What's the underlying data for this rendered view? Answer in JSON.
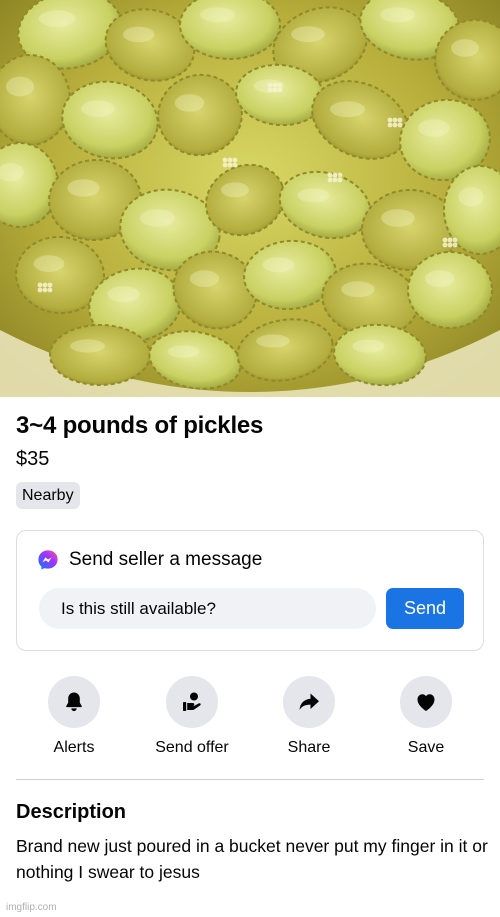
{
  "listing": {
    "photo_alt": "pickle-slices-photo",
    "title": "3~4 pounds of pickles",
    "price": "$35",
    "location_badge": "Nearby"
  },
  "message_card": {
    "icon": "messenger-icon",
    "heading": "Send seller a message",
    "input_value": "Is this still available?",
    "send_label": "Send"
  },
  "actions": [
    {
      "icon": "bell-icon",
      "label": "Alerts"
    },
    {
      "icon": "send-offer-icon",
      "label": "Send offer"
    },
    {
      "icon": "share-arrow-icon",
      "label": "Share"
    },
    {
      "icon": "heart-icon",
      "label": "Save"
    }
  ],
  "description": {
    "heading": "Description",
    "body": "Brand new just poured in a bucket never put my finger in it or nothing I swear to jesus"
  },
  "watermark": "imgflip.com",
  "colors": {
    "accent": "#1b74e4",
    "chip_bg": "#e4e6eb",
    "input_bg": "#f0f2f5",
    "pickle_brine": "#c9c24a",
    "pickle_slice": "#cfd86a"
  }
}
